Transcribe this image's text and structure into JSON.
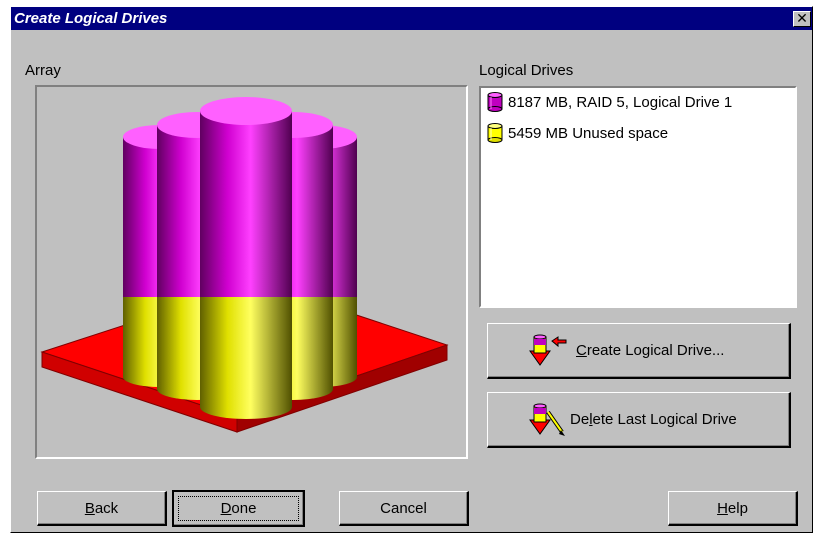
{
  "window": {
    "title": "Create Logical Drives",
    "close_glyph": "✕"
  },
  "array_panel": {
    "label": "Array"
  },
  "logical_drives": {
    "label": "Logical Drives",
    "items": [
      {
        "text": "8187 MB, RAID 5, Logical Drive 1",
        "icon": "purple-drive-icon",
        "color": "#c000c0"
      },
      {
        "text": "5459 MB Unused space",
        "icon": "yellow-drive-icon",
        "color": "#ffff00"
      }
    ]
  },
  "actions": {
    "create": {
      "pre": "",
      "accel": "C",
      "post": "reate Logical Drive..."
    },
    "delete": {
      "pre": "De",
      "accel": "l",
      "post": "ete Last Logical Drive"
    }
  },
  "footer": {
    "back": {
      "accel": "B",
      "rest": "ack"
    },
    "done": {
      "accel": "D",
      "rest": "one"
    },
    "cancel": "Cancel",
    "help": {
      "accel": "H",
      "rest": "elp"
    }
  },
  "colors": {
    "dialog_bg": "#c0c0c0",
    "titlebar": "#000080",
    "raid_drive": "#c000c0",
    "unused_space": "#ffff00",
    "base_plate": "#ff0000"
  }
}
